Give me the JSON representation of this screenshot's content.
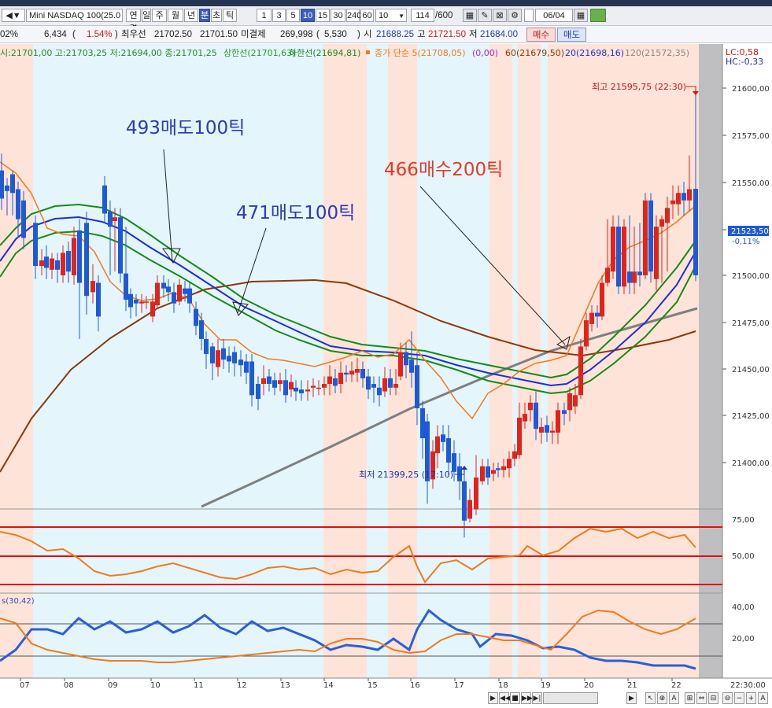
{
  "toolbar": {
    "symbol": "Mini NASDAQ 100(25.0",
    "period_buttons": [
      "연결",
      "일",
      "주",
      "월",
      "년",
      "분",
      "초",
      "틱"
    ],
    "interval_buttons": [
      "1",
      "3",
      "5",
      "10",
      "15",
      "30",
      "240",
      "60"
    ],
    "interval_value": "10",
    "count_value": "114",
    "count_total": "/600",
    "date_value": "06/04"
  },
  "quote": {
    "change_pct_left": "02%",
    "volume": "6,434",
    "change_pct": "1.54%",
    "best_ask_label": "최우선",
    "best_ask": "21702.50",
    "best_bid": "21701.50",
    "open_interest_label": "미결제",
    "open_interest": "269,998",
    "oi_change": "5,530",
    "open_label": "시",
    "open": "21688.25",
    "high_label": "고",
    "high": "21721.50",
    "low_label": "저",
    "low": "21684.00",
    "buy_button": "매수",
    "sell_button": "매도"
  },
  "legend": {
    "ohlc": "시:21701,00 고:21703,25 저:21694,00 종:21701,25",
    "upper_band": "상한선(21701,63)",
    "lower_band": "하한선(21694,81)",
    "ma_label": "종가 단순 5(21708,05)",
    "ma_zero": "(0,00)",
    "ma60": "60(21679,50)",
    "ma20": "20(21698,16)",
    "ma120": "120(21572,35)",
    "lc": "LC:0,58",
    "hc": "HC:-0,33"
  },
  "annotations": {
    "sell1": "493매도100틱",
    "sell2": "471매도100틱",
    "buy1": "466매수200틱",
    "high_mark": "최고 21595,75 (22:30)",
    "low_mark": "최저 21399,25 (17:10)"
  },
  "price_axis": {
    "ticks": [
      "21600,00",
      "21575,00",
      "21550,00",
      "21525,00",
      "21500,00",
      "21475,00",
      "21450,00",
      "21425,00",
      "21400,00"
    ],
    "current": "21523,50",
    "current_change": "-0,11%"
  },
  "stoch_axis": {
    "ticks": [
      "75,00",
      "50,00"
    ]
  },
  "lower_panel": {
    "label": "s(30,42)",
    "ticks": [
      "40,00",
      "20,00"
    ]
  },
  "time_axis": {
    "ticks": [
      "07",
      "08",
      "09",
      "10",
      "11",
      "12",
      "13",
      "14",
      "15",
      "16",
      "17",
      "18",
      "19",
      "20",
      "21",
      "22"
    ],
    "end_label": "22:30:00"
  },
  "colors": {
    "up_candle": "#e0241b",
    "down_candle": "#1e5ad8",
    "buy_zone": "#fde3d8",
    "sell_zone": "#e4f6fb",
    "annotation_blue": "#2c39b8",
    "annotation_red": "#e23a2a"
  },
  "chart_data": {
    "type": "candlestick",
    "ylim": [
      21385,
      21620
    ],
    "y_ticks": [
      21400,
      21425,
      21450,
      21475,
      21500,
      21525,
      21550,
      21575,
      21600
    ],
    "high": 21595.75,
    "low": 21399.25,
    "last": 21523.5
  }
}
